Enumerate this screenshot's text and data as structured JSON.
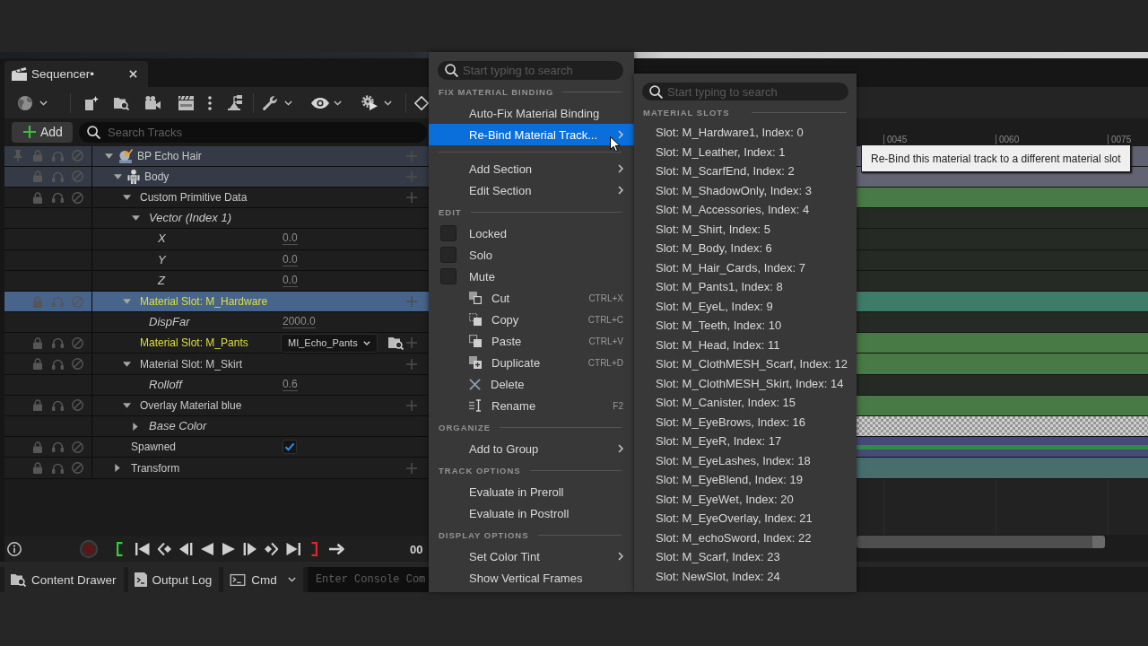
{
  "tab": {
    "label": "Sequencer•"
  },
  "add_button": {
    "label": "Add"
  },
  "search": {
    "placeholder": "Search Tracks"
  },
  "tracks": [
    {
      "label": "BP Echo Hair",
      "kind": "actor",
      "selected": false,
      "expanded": true,
      "children": [
        {
          "label": "Body",
          "kind": "component",
          "selected": false,
          "expanded": true,
          "children": [
            {
              "label": "Custom Primitive Data",
              "kind": "track",
              "selected": false,
              "expanded": true,
              "children": [
                {
                  "label": "Vector (Index 1)",
                  "kind": "property",
                  "selected": false,
                  "expanded": true,
                  "children": [
                    {
                      "label": "X",
                      "kind": "property",
                      "selected": false,
                      "value": "0.0"
                    },
                    {
                      "label": "Y",
                      "kind": "property",
                      "selected": false,
                      "value": "0.0"
                    },
                    {
                      "label": "Z",
                      "kind": "property",
                      "selected": false,
                      "value": "0.0"
                    }
                  ]
                }
              ]
            },
            {
              "label": "Material Slot: M_Hardware",
              "kind": "track",
              "selected": true,
              "color": "#dede3c",
              "expanded": true,
              "children": [
                {
                  "label": "DispFar",
                  "kind": "property",
                  "selected": false,
                  "value": "2000.0"
                }
              ]
            },
            {
              "label": "Material Slot: M_Pants",
              "kind": "track",
              "selected": false,
              "color": "#dede3c",
              "dropdown": "MI_Echo_Pants"
            },
            {
              "label": "Material Slot: M_Skirt",
              "kind": "track",
              "selected": false,
              "expanded": true,
              "children": [
                {
                  "label": "Rolloff",
                  "kind": "property",
                  "selected": false,
                  "value": "0.6"
                }
              ]
            },
            {
              "label": "Overlay Material blue",
              "kind": "track",
              "selected": false,
              "expanded": true,
              "children": [
                {
                  "label": "Base Color",
                  "kind": "property",
                  "selected": false,
                  "expanded": false
                }
              ]
            }
          ]
        },
        {
          "label": "Spawned",
          "kind": "track",
          "selected": false,
          "checked": true
        },
        {
          "label": "Transform",
          "kind": "track",
          "selected": false,
          "expanded": false
        }
      ]
    }
  ],
  "timeline": {
    "ticks": [
      "0045",
      "0060",
      "0075"
    ],
    "rows": [
      {
        "kind": "bar",
        "color": "#5f6070"
      },
      {
        "kind": "bar",
        "color": "#636373"
      },
      {
        "kind": "bar",
        "color": "#477a44"
      },
      {
        "kind": "empty"
      },
      {
        "kind": "empty"
      },
      {
        "kind": "empty"
      },
      {
        "kind": "empty"
      },
      {
        "kind": "bar",
        "color": "#3d7c69"
      },
      {
        "kind": "empty"
      },
      {
        "kind": "bar",
        "color": "#477a44"
      },
      {
        "kind": "bar",
        "color": "#477a44"
      },
      {
        "kind": "empty"
      },
      {
        "kind": "bar",
        "color": "#477a44"
      },
      {
        "kind": "checker"
      },
      {
        "kind": "bool",
        "color": "#474a78"
      },
      {
        "kind": "bar",
        "color": "#456e6c"
      }
    ]
  },
  "transport": {
    "timecode": "00"
  },
  "status_bar": {
    "items": [
      {
        "label": "Content Drawer",
        "kind": "drawer"
      },
      {
        "label": "Output Log",
        "kind": "log"
      },
      {
        "label": "Cmd",
        "kind": "cmd"
      }
    ],
    "console": {
      "placeholder": "Enter Console Com"
    }
  },
  "context_menu": {
    "search": {
      "placeholder": "Start typing to search"
    },
    "sections": [
      {
        "header": "FIX MATERIAL BINDING",
        "items": [
          {
            "label": "Auto-Fix Material Binding",
            "kind": "action",
            "selected": false
          },
          {
            "label": "Re-Bind Material Track...",
            "kind": "submenu",
            "selected": true
          }
        ]
      },
      {
        "items": [
          {
            "label": "Add Section",
            "kind": "submenu",
            "selected": false
          },
          {
            "label": "Edit Section",
            "kind": "submenu",
            "selected": false
          }
        ]
      },
      {
        "header": "EDIT",
        "items": [
          {
            "label": "Locked",
            "kind": "check",
            "checked": false,
            "selected": false
          },
          {
            "label": "Solo",
            "kind": "check",
            "checked": false,
            "selected": false
          },
          {
            "label": "Mute",
            "kind": "check",
            "checked": false,
            "selected": false
          },
          {
            "label": "Cut",
            "kind": "command",
            "shortcut": "CTRL+X",
            "selected": false
          },
          {
            "label": "Copy",
            "kind": "command",
            "shortcut": "CTRL+C",
            "selected": false
          },
          {
            "label": "Paste",
            "kind": "command",
            "shortcut": "CTRL+V",
            "selected": false
          },
          {
            "label": "Duplicate",
            "kind": "command",
            "shortcut": "CTRL+D",
            "selected": false
          },
          {
            "label": "Delete",
            "kind": "command",
            "selected": false
          },
          {
            "label": "Rename",
            "kind": "command",
            "shortcut": "F2",
            "selected": false
          }
        ]
      },
      {
        "header": "ORGANIZE",
        "items": [
          {
            "label": "Add to Group",
            "kind": "submenu",
            "selected": false
          }
        ]
      },
      {
        "header": "TRACK OPTIONS",
        "items": [
          {
            "label": "Evaluate in Preroll",
            "kind": "action",
            "selected": false
          },
          {
            "label": "Evaluate in Postroll",
            "kind": "action",
            "selected": false
          }
        ]
      },
      {
        "header": "DISPLAY OPTIONS",
        "items": [
          {
            "label": "Set Color Tint",
            "kind": "submenu",
            "selected": false
          },
          {
            "label": "Show Vertical Frames",
            "kind": "action",
            "selected": false
          }
        ]
      }
    ]
  },
  "slot_menu": {
    "search": {
      "placeholder": "Start typing to search"
    },
    "header": "MATERIAL SLOTS",
    "items": [
      "Slot: M_Hardware1, Index: 0",
      "Slot: M_Leather, Index: 1",
      "Slot: M_ScarfEnd, Index: 2",
      "Slot: M_ShadowOnly, Index: 3",
      "Slot: M_Accessories, Index: 4",
      "Slot: M_Shirt, Index: 5",
      "Slot: M_Body, Index: 6",
      "Slot: M_Hair_Cards, Index: 7",
      "Slot: M_Pants1, Index: 8",
      "Slot: M_EyeL, Index: 9",
      "Slot: M_Teeth, Index: 10",
      "Slot: M_Head, Index: 11",
      "Slot: M_ClothMESH_Scarf, Index: 12",
      "Slot: M_ClothMESH_Skirt, Index: 14",
      "Slot: M_Canister, Index: 15",
      "Slot: M_EyeBrows, Index: 16",
      "Slot: M_EyeR, Index: 17",
      "Slot: M_EyeLashes, Index: 18",
      "Slot: M_EyeBlend, Index: 19",
      "Slot: M_EyeWet, Index: 20",
      "Slot: M_EyeOverlay, Index: 21",
      "Slot: M_echoSword, Index: 22",
      "Slot: M_Scarf, Index: 23",
      "Slot: NewSlot, Index: 24"
    ]
  },
  "tooltip": {
    "text": "Re-Bind this material track to a different material slot"
  }
}
